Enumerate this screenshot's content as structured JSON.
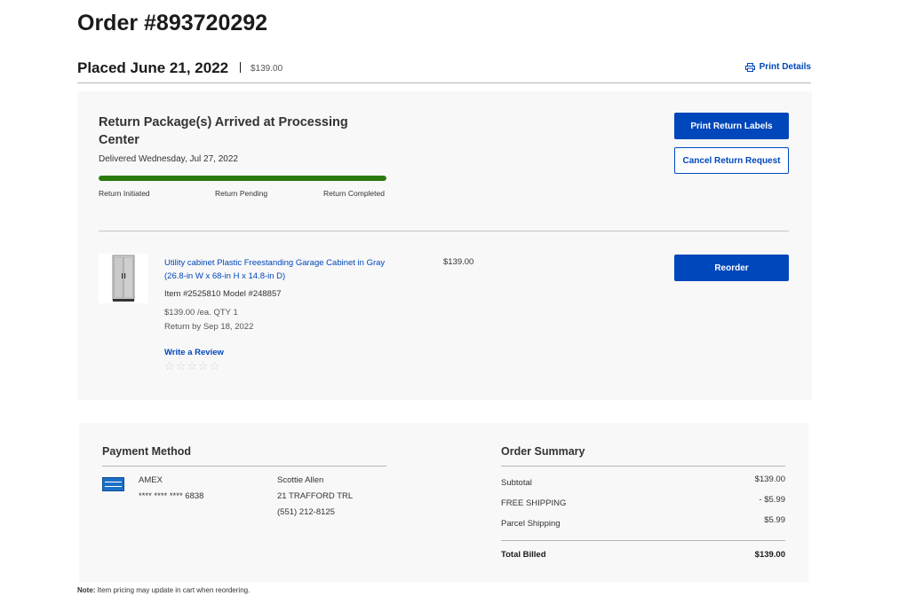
{
  "order": {
    "title": "Order #893720292",
    "placed": "Placed June 21, 2022",
    "total": "$139.00",
    "print_details": "Print Details"
  },
  "status": {
    "title": "Return Package(s) Arrived at Processing Center",
    "delivered": "Delivered Wednesday, Jul 27, 2022",
    "progress_percent": 100,
    "progress_color": "#2a7a0b",
    "steps": [
      "Return Initiated",
      "Return Pending",
      "Return Completed"
    ],
    "print_labels_button": "Print Return Labels",
    "cancel_button": "Cancel Return Request"
  },
  "item": {
    "name": "Utility cabinet Plastic Freestanding Garage Cabinet in Gray (26.8-in W x 68-in H x 14.8-in D)",
    "price": "$139.00",
    "ids": "Item #2525810 Model #248857",
    "unit_qty": "$139.00 /ea. QTY 1",
    "return_by": "Return by Sep 18, 2022",
    "review_link": "Write a Review",
    "rating": 0,
    "reorder_button": "Reorder"
  },
  "payment": {
    "title": "Payment Method",
    "card_brand": "AMEX",
    "card_number": "**** **** **** 6838",
    "card_icon": "amex-card-icon",
    "name": "Scottie Allen",
    "address": "21 TRAFFORD TRL",
    "phone": "(551) 212-8125"
  },
  "summary": {
    "title": "Order Summary",
    "rows": [
      {
        "label": "Subtotal",
        "value": "$139.00"
      },
      {
        "label": "FREE SHIPPING",
        "value": "- $5.99"
      },
      {
        "label": "Parcel Shipping",
        "value": "$5.99"
      }
    ],
    "total_label": "Total Billed",
    "total_value": "$139.00"
  },
  "note": {
    "label": "Note:",
    "text": " Item pricing may update in cart when reordering."
  },
  "colors": {
    "accent": "#0047bb",
    "card_bg": "#f8f8f8"
  }
}
